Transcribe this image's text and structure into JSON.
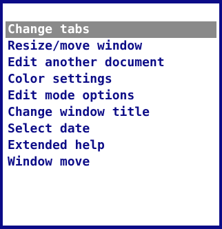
{
  "menu": {
    "items": [
      {
        "label": "Change tabs",
        "selected": true
      },
      {
        "label": "Resize/move window",
        "selected": false
      },
      {
        "label": "Edit another document",
        "selected": false
      },
      {
        "label": "Color settings",
        "selected": false
      },
      {
        "label": "Edit mode options",
        "selected": false
      },
      {
        "label": "Change window title",
        "selected": false
      },
      {
        "label": "Select date",
        "selected": false
      },
      {
        "label": "Extended help",
        "selected": false
      },
      {
        "label": "Window move",
        "selected": false
      }
    ]
  },
  "colors": {
    "frame": "#0c0c87",
    "text": "#0c0c87",
    "highlight_bg": "#8a8a8a",
    "highlight_text": "#ffffff",
    "background": "#ffffff"
  }
}
